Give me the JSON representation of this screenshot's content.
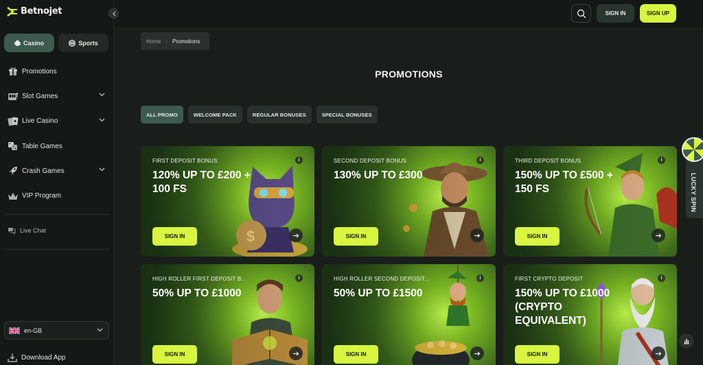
{
  "brand": {
    "logo_text": "Betnojet"
  },
  "sidebar": {
    "switch": [
      {
        "label": "Casino",
        "icon": "spade-icon",
        "active": true
      },
      {
        "label": "Sports",
        "icon": "ball-icon",
        "active": false
      }
    ],
    "items": [
      {
        "label": "Promotions",
        "icon": "gift-icon",
        "expandable": false
      },
      {
        "label": "Slot Games",
        "icon": "slot-machine-icon",
        "expandable": true
      },
      {
        "label": "Live Casino",
        "icon": "cards-icon",
        "expandable": true
      },
      {
        "label": "Table Games",
        "icon": "dice-icon",
        "expandable": false
      },
      {
        "label": "Crash Games",
        "icon": "rocket-icon",
        "expandable": true
      },
      {
        "label": "VIP Program",
        "icon": "crown-icon",
        "expandable": false
      }
    ],
    "live_chat": "Live Chat",
    "language": "en-GB",
    "download": "Download App"
  },
  "header": {
    "signin": "SIGN IN",
    "signup": "SIGN UP"
  },
  "breadcrumb": {
    "home": "Home",
    "current": "Promotions"
  },
  "page_title": "PROMOTIONS",
  "filters": [
    {
      "label": "ALL PROMO",
      "active": true
    },
    {
      "label": "WELCOME PACK",
      "active": false
    },
    {
      "label": "REGULAR BONUSES",
      "active": false
    },
    {
      "label": "SPECIAL BONUSES",
      "active": false
    }
  ],
  "cards": [
    {
      "tag": "FIRST DEPOSIT BONUS",
      "offer": "120% UP TO £200 + 100 FS",
      "cta": "SIGN IN",
      "info": "i"
    },
    {
      "tag": "SECOND DEPOSIT BONUS",
      "offer": "130% UP TO £300",
      "cta": "SIGN IN",
      "info": "i"
    },
    {
      "tag": "THIRD DEPOSIT BONUS",
      "offer": "150% UP TO £500 + 150 FS",
      "cta": "SIGN IN",
      "info": "i"
    },
    {
      "tag": "HIGH ROLLER FIRST DEPOSIT B...",
      "offer": "50% UP TO £1000",
      "cta": "SIGN IN",
      "info": "i"
    },
    {
      "tag": "HIGH ROLLER SECOND DEPOSIT...",
      "offer": "50% UP TO £1500",
      "cta": "SIGN IN",
      "info": "i"
    },
    {
      "tag": "FIRST CRYPTO DEPOSIT",
      "offer": "150% UP TO £1000 (CRYPTO EQUIVALENT)",
      "cta": "SIGN IN",
      "info": "i"
    }
  ],
  "lucky_spin": "LUCKY SPIN",
  "colors": {
    "accent": "#d8f540",
    "active_tab": "#3d5a4f",
    "background": "#191e1b"
  }
}
